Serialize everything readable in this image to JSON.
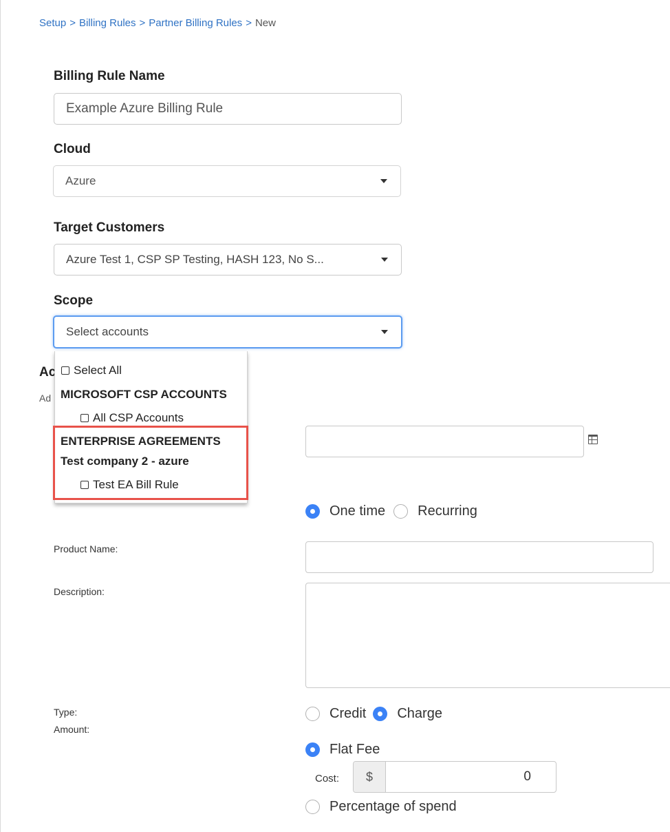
{
  "breadcrumb": [
    {
      "label": "Setup",
      "link": true
    },
    {
      "label": "Billing Rules",
      "link": true
    },
    {
      "label": "Partner Billing Rules",
      "link": true
    },
    {
      "label": "New",
      "link": false
    }
  ],
  "breadcrumb_separator": ">",
  "form": {
    "name_label": "Billing Rule Name",
    "name_value": "Example Azure Billing Rule",
    "cloud_label": "Cloud",
    "cloud_value": "Azure",
    "target_label": "Target Customers",
    "target_value": "Azure Test 1, CSP SP Testing, HASH 123, No S...",
    "scope_label": "Scope",
    "scope_placeholder": "Select accounts"
  },
  "scope_dropdown": {
    "select_all": "Select All",
    "groups": [
      {
        "header": "MICROSOFT CSP ACCOUNTS",
        "items": [
          "All CSP Accounts"
        ]
      },
      {
        "header": "ENTERPRISE AGREEMENTS",
        "subheader": "Test company 2 - azure",
        "items": [
          "Test EA Bill Rule"
        ]
      }
    ]
  },
  "hidden_section": {
    "heading_fragment": "Ac",
    "sub_fragment": "Ad"
  },
  "rule": {
    "frequency_options": [
      "One time",
      "Recurring"
    ],
    "frequency_selected": "One time",
    "product_label": "Product Name:",
    "description_label": "Description:",
    "type_label": "Type:",
    "type_options": [
      "Credit",
      "Charge"
    ],
    "type_selected": "Charge",
    "amount_label": "Amount:",
    "amount_options": [
      "Flat Fee",
      "Percentage of spend"
    ],
    "amount_selected": "Flat Fee",
    "cost_label": "Cost:",
    "cost_currency": "$",
    "cost_value": "0"
  },
  "colors": {
    "link": "#2f72c4",
    "radio_selected": "#3b82f6",
    "focus": "#5b9bf0",
    "highlight": "#e8524a"
  }
}
